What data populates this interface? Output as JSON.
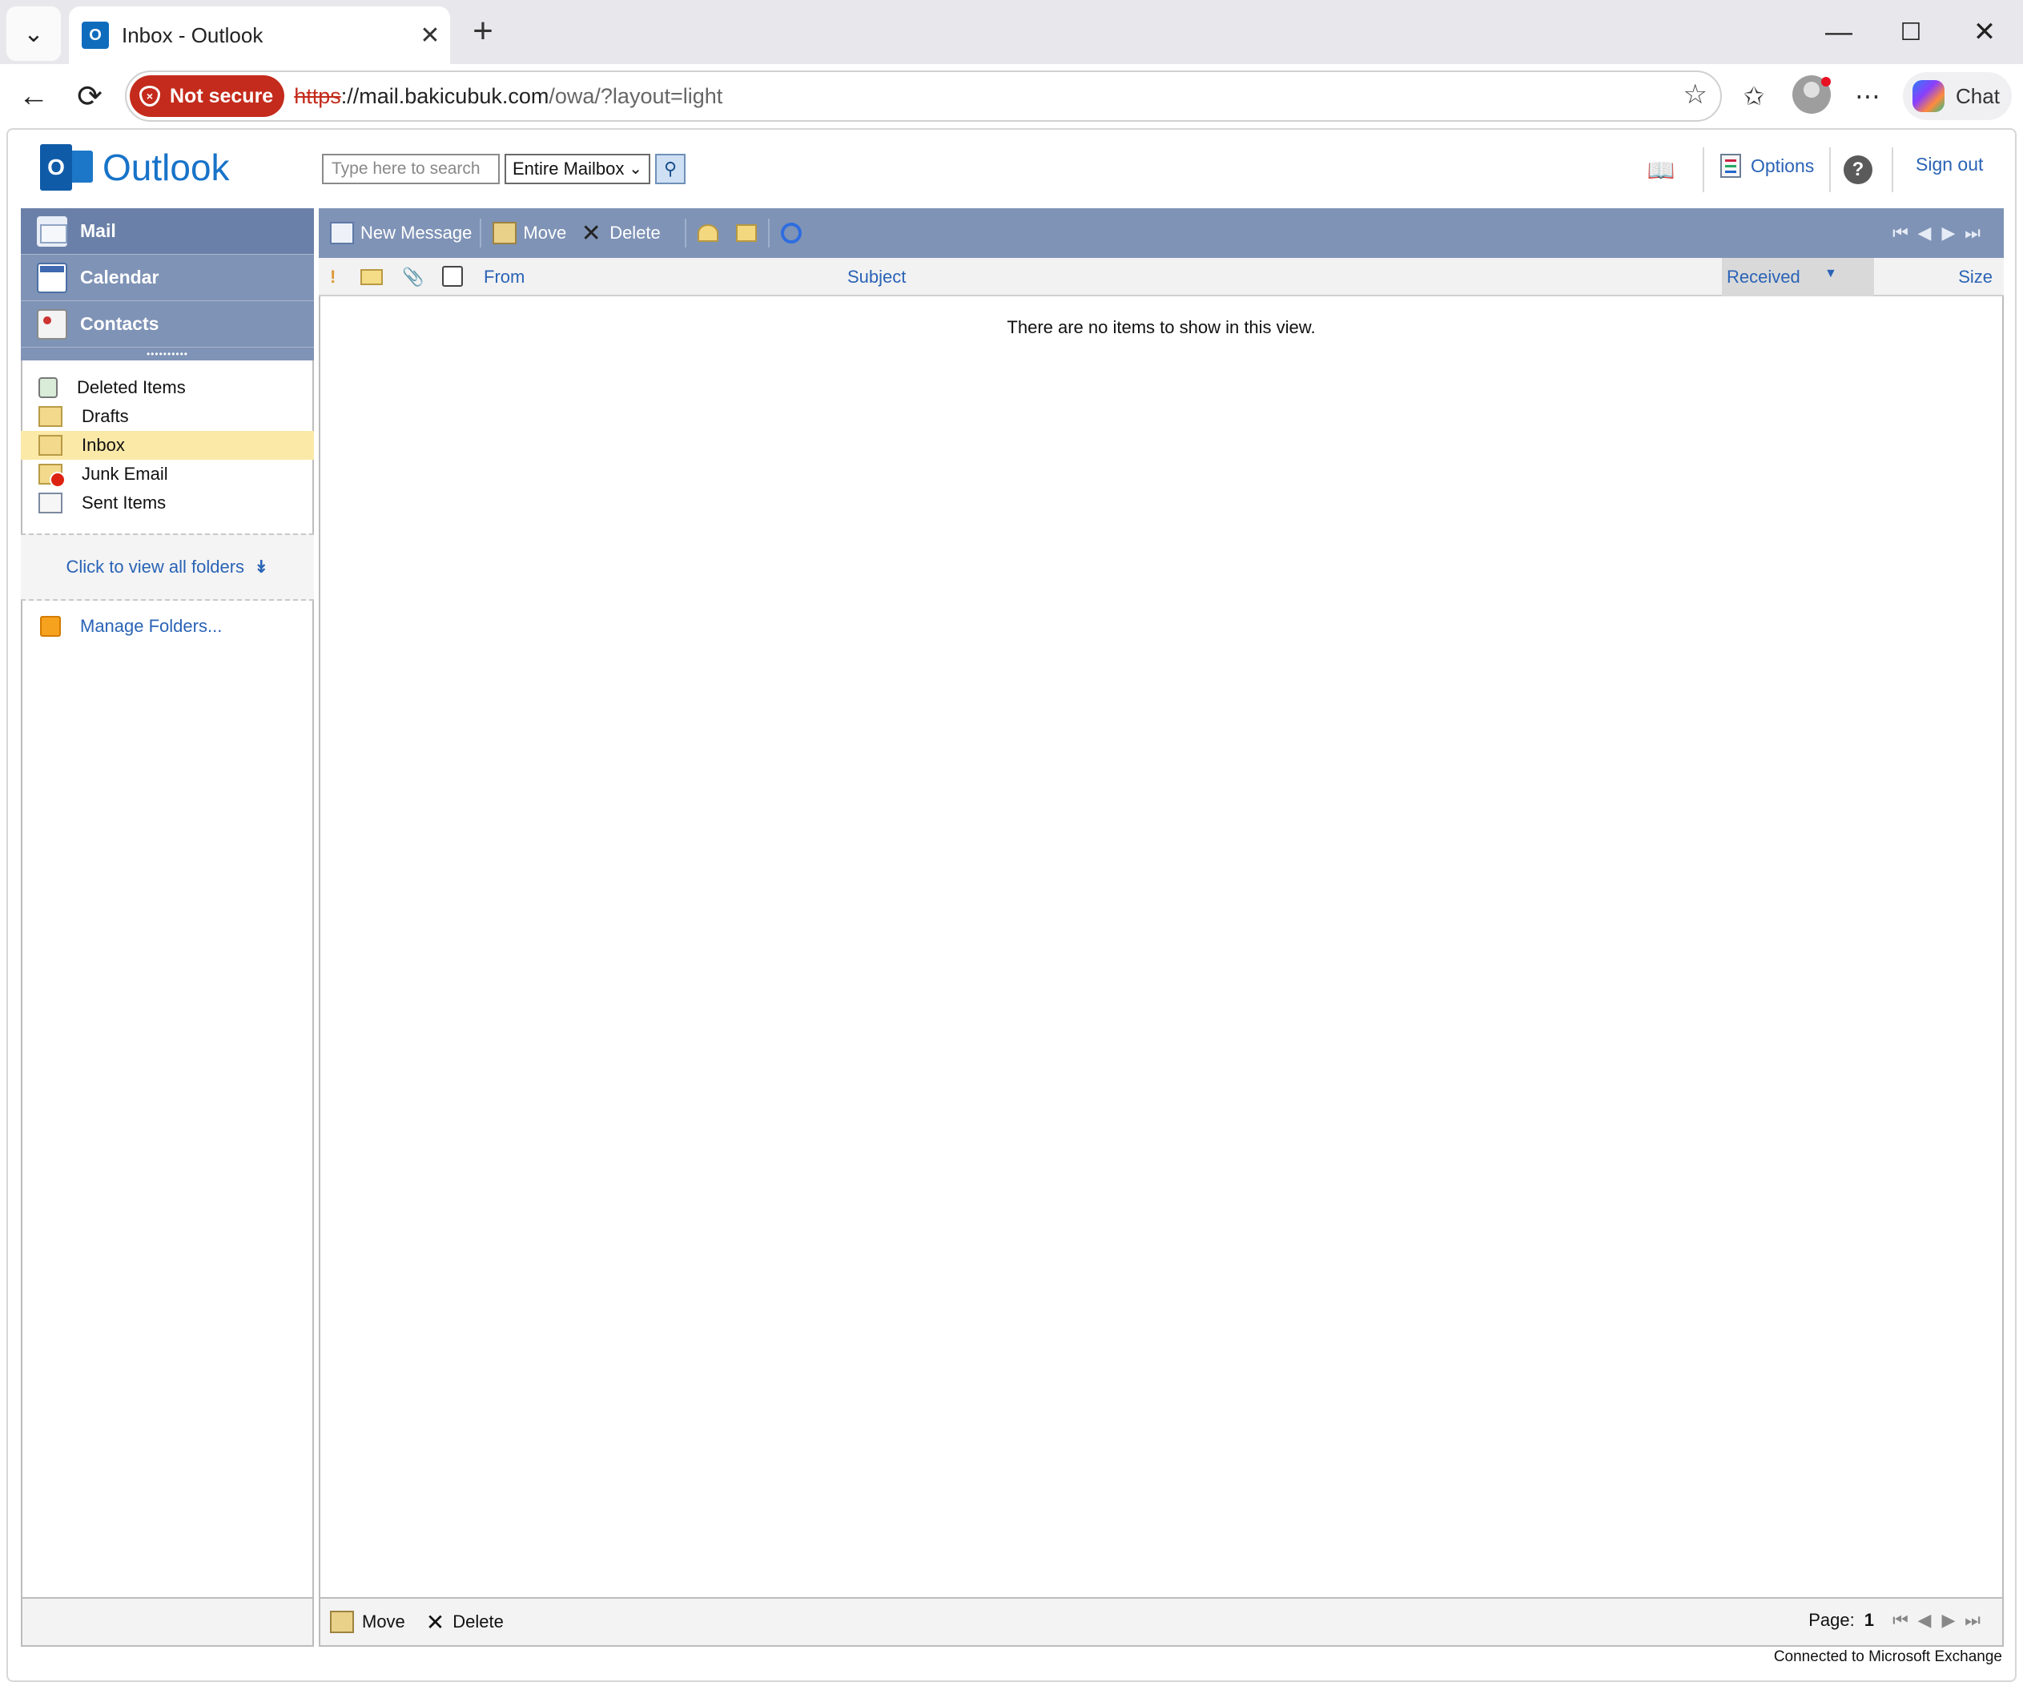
{
  "browser": {
    "tab_title": "Inbox - Outlook",
    "tab_favicon_letter": "O",
    "security_label": "Not secure",
    "url_scheme": "https",
    "url_host": "://mail.bakicubuk.com",
    "url_path": "/owa/?layout=light",
    "chat_label": "Chat"
  },
  "owa": {
    "logo_text": "Outlook",
    "search_placeholder": "Type here to search",
    "search_scope": "Entire Mailbox",
    "options_label": "Options",
    "help_label": "?",
    "signout_label": "Sign out"
  },
  "nav": {
    "modules": [
      {
        "label": "Mail"
      },
      {
        "label": "Calendar"
      },
      {
        "label": "Contacts"
      }
    ],
    "folders": [
      {
        "label": "Deleted Items"
      },
      {
        "label": "Drafts"
      },
      {
        "label": "Inbox",
        "selected": true
      },
      {
        "label": "Junk Email"
      },
      {
        "label": "Sent Items"
      }
    ],
    "view_all_label": "Click to view all folders",
    "manage_folders_label": "Manage Folders..."
  },
  "toolbar": {
    "new_message_label": "New Message",
    "move_label": "Move",
    "delete_label": "Delete"
  },
  "list": {
    "columns": {
      "from": "From",
      "subject": "Subject",
      "received": "Received",
      "size": "Size"
    },
    "empty_message": "There are no items to show in this view."
  },
  "bottom": {
    "move_label": "Move",
    "delete_label": "Delete",
    "page_label": "Page:",
    "page_number": "1"
  },
  "status": {
    "connection": "Connected to Microsoft Exchange"
  },
  "colors": {
    "nav_module_bg": "#7f93b6",
    "selected_folder_bg": "#fbe9a8",
    "link_blue": "#2a63b6",
    "not_secure_red": "#c42b1c"
  }
}
